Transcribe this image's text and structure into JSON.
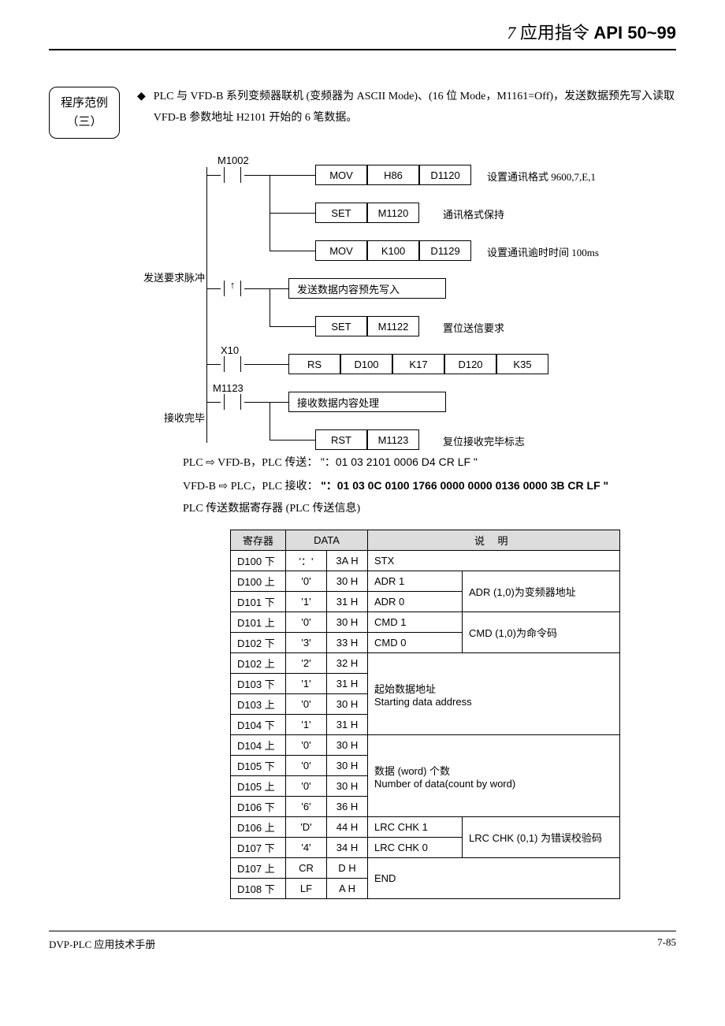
{
  "header": {
    "num": "7",
    "cn": "应用指令",
    "api": "API 50~99"
  },
  "example_box": {
    "line1": "程序范例",
    "line2": "（三）"
  },
  "intro": "PLC 与 VFD-B 系列变频器联机 (变频器为 ASCII Mode)、(16 位 Mode，M1161=Off)，发送数据预先写入读取 VFD-B 参数地址 H2101 开始的 6 笔数据。",
  "ladder": {
    "c1": {
      "label": "M1002"
    },
    "r1": {
      "b1": "MOV",
      "b2": "H86",
      "b3": "D1120",
      "note": "设置通讯格式 9600,7,E,1"
    },
    "r2": {
      "b1": "SET",
      "b2": "M1120",
      "note": "通讯格式保持"
    },
    "r3": {
      "b1": "MOV",
      "b2": "K100",
      "b3": "D1129",
      "note": "设置通讯逾时时间 100ms"
    },
    "c2": {
      "label": "发送要求脉冲"
    },
    "r4": {
      "text": "发送数据内容预先写入"
    },
    "r5": {
      "b1": "SET",
      "b2": "M1122",
      "note": "置位送信要求"
    },
    "c3": {
      "label": "X10"
    },
    "r6": {
      "b1": "RS",
      "b2": "D100",
      "b3": "K17",
      "b4": "D120",
      "b5": "K35"
    },
    "c4": {
      "label": "M1123",
      "side": "接收完毕"
    },
    "r7": {
      "text": "接收数据内容处理"
    },
    "r8": {
      "b1": "RST",
      "b2": "M1123",
      "note": "复位接收完毕标志"
    }
  },
  "tx1_label": "PLC ⇨ VFD-B，PLC 传送：",
  "tx1_data": "\"：01 03 2101 0006 D4 CR LF \"",
  "tx2_label": "VFD-B ⇨ PLC，PLC 接收：",
  "tx2_data": "\"：01 03 0C 0100 1766 0000 0000 0136 0000 3B CR LF \"",
  "tx3": "PLC 传送数据寄存器 (PLC 传送信息)",
  "thead": {
    "c1": "寄存器",
    "c2": "DATA",
    "c3": "说    明"
  },
  "rows": [
    {
      "reg": "D100 下",
      "ch": "'：'",
      "hex": "3A H",
      "d": "STX"
    },
    {
      "reg": "D100 上",
      "ch": "'0'",
      "hex": "30 H",
      "d": "ADR 1"
    },
    {
      "reg": "D101 下",
      "ch": "'1'",
      "hex": "31 H",
      "d": "ADR 0"
    },
    {
      "reg": "D101 上",
      "ch": "'0'",
      "hex": "30 H",
      "d": "CMD 1"
    },
    {
      "reg": "D102 下",
      "ch": "'3'",
      "hex": "33 H",
      "d": "CMD 0"
    },
    {
      "reg": "D102 上",
      "ch": "'2'",
      "hex": "32 H"
    },
    {
      "reg": "D103 下",
      "ch": "'1'",
      "hex": "31 H"
    },
    {
      "reg": "D103 上",
      "ch": "'0'",
      "hex": "30 H"
    },
    {
      "reg": "D104 下",
      "ch": "'1'",
      "hex": "31 H"
    },
    {
      "reg": "D104 上",
      "ch": "'0'",
      "hex": "30 H"
    },
    {
      "reg": "D105 下",
      "ch": "'0'",
      "hex": "30 H"
    },
    {
      "reg": "D105 上",
      "ch": "'0'",
      "hex": "30 H"
    },
    {
      "reg": "D106 下",
      "ch": "'6'",
      "hex": "36 H"
    },
    {
      "reg": "D106 上",
      "ch": "'D'",
      "hex": "44 H",
      "d": "LRC CHK 1"
    },
    {
      "reg": "D107 下",
      "ch": "'4'",
      "hex": "34 H",
      "d": "LRC CHK 0"
    },
    {
      "reg": "D107 上",
      "ch": "CR",
      "hex": "D H"
    },
    {
      "reg": "D108 下",
      "ch": "LF",
      "hex": "A H"
    }
  ],
  "merge": {
    "adr": "ADR (1,0)为变频器地址",
    "cmd": "CMD (1,0)为命令码",
    "start": "起始数据地址\nStarting data address",
    "count": "数据 (word) 个数\nNumber of data(count by word)",
    "lrc": "LRC CHK (0,1) 为错误校验码",
    "end": "END"
  },
  "footer": {
    "left": "DVP-PLC 应用技术手册",
    "right": "7-85"
  }
}
